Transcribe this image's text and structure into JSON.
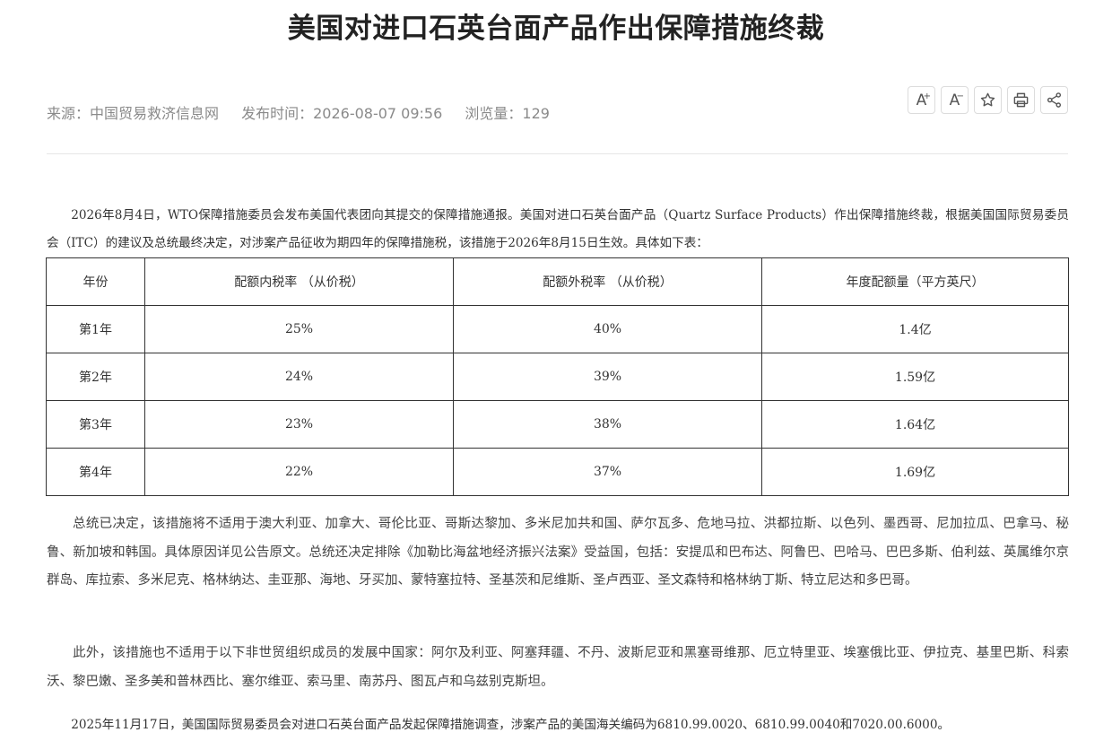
{
  "article": {
    "title": "美国对进口石英台面产品作出保障措施终裁",
    "source": "来源：中国贸易救济信息网",
    "published": "发布时间：2026-08-07 09:56",
    "views": "浏览量：129"
  },
  "toolbar": {
    "font_increase": "A",
    "font_increase_sup": "+",
    "font_decrease": "A",
    "font_decrease_sup": "−",
    "icons": [
      "font-increase-icon",
      "font-decrease-icon",
      "star-icon",
      "print-icon",
      "share-icon"
    ]
  },
  "body": {
    "intro": "2026年8月4日，WTO保障措施委员会发布美国代表团向其提交的保障措施通报。美国对进口石英台面产品（Quartz Surface Products）作出保障措施终裁，根据美国国际贸易委员会（ITC）的建议及总统最终决定，对涉案产品征收为期四年的保障措施税，该措施于2026年8月15日生效。具体如下表：",
    "exclusions": "总统已决定，该措施将不适用于澳大利亚、加拿大、哥伦比亚、哥斯达黎加、多米尼加共和国、萨尔瓦多、危地马拉、洪都拉斯、以色列、墨西哥、尼加拉瓜、巴拿马、秘鲁、新加坡和韩国。具体原因详见公告原文。总统还决定排除《加勒比海盆地经济振兴法案》受益国，包括：安提瓜和巴布达、阿鲁巴、巴哈马、巴巴多斯、伯利兹、英属维尔京群岛、库拉索、多米尼克、格林纳达、圭亚那、海地、牙买加、蒙特塞拉特、圣基茨和尼维斯、圣卢西亚、圣文森特和格林纳丁斯、特立尼达和多巴哥。",
    "developing": "此外，该措施也不适用于以下非世贸组织成员的发展中国家：阿尔及利亚、阿塞拜疆、不丹、波斯尼亚和黑塞哥维那、厄立特里亚、埃塞俄比亚、伊拉克、基里巴斯、科索沃、黎巴嫩、圣多美和普林西比、塞尔维亚、索马里、南苏丹、图瓦卢和乌兹别克斯坦。",
    "history": "2025年11月17日，美国国际贸易委员会对进口石英台面产品发起保障措施调查，涉案产品的美国海关编码为6810.99.0020、6810.99.0040和7020.00.6000。"
  },
  "table": {
    "headers": [
      "年份",
      "配额内税率 （从价税）",
      "配额外税率 （从价税）",
      "年度配额量（平方英尺）"
    ],
    "rows": [
      [
        "第1年",
        "25%",
        "40%",
        "1.4亿"
      ],
      [
        "第2年",
        "24%",
        "39%",
        "1.59亿"
      ],
      [
        "第3年",
        "23%",
        "38%",
        "1.64亿"
      ],
      [
        "第4年",
        "22%",
        "37%",
        "1.69亿"
      ]
    ]
  }
}
